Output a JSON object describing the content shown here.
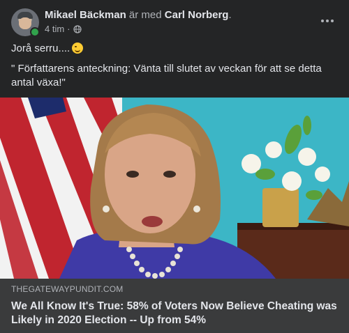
{
  "post": {
    "author": "Mikael Bäckman",
    "with_text": "är med",
    "tagged": "Carl Norberg",
    "tagged_suffix": ".",
    "time": "4 tim",
    "separator": "·",
    "privacy_icon": "globe-icon",
    "line1": "Jorå serru....",
    "line1_emoji": "winking-face-emoji",
    "line2": "\" Författarens anteckning: Vänta till slutet av veckan för att se detta antal växa!\""
  },
  "link": {
    "domain": "THEGATEWAYPUNDIT.COM",
    "title": "We All Know It's True: 58% of Voters Now Believe Cheating was Likely in 2020 Election -- Up from 54%"
  },
  "colors": {
    "background": "#242526",
    "link_box": "#3a3b3c",
    "online": "#31a24c",
    "text_primary": "#e4e6eb",
    "text_secondary": "#b0b3b8"
  }
}
